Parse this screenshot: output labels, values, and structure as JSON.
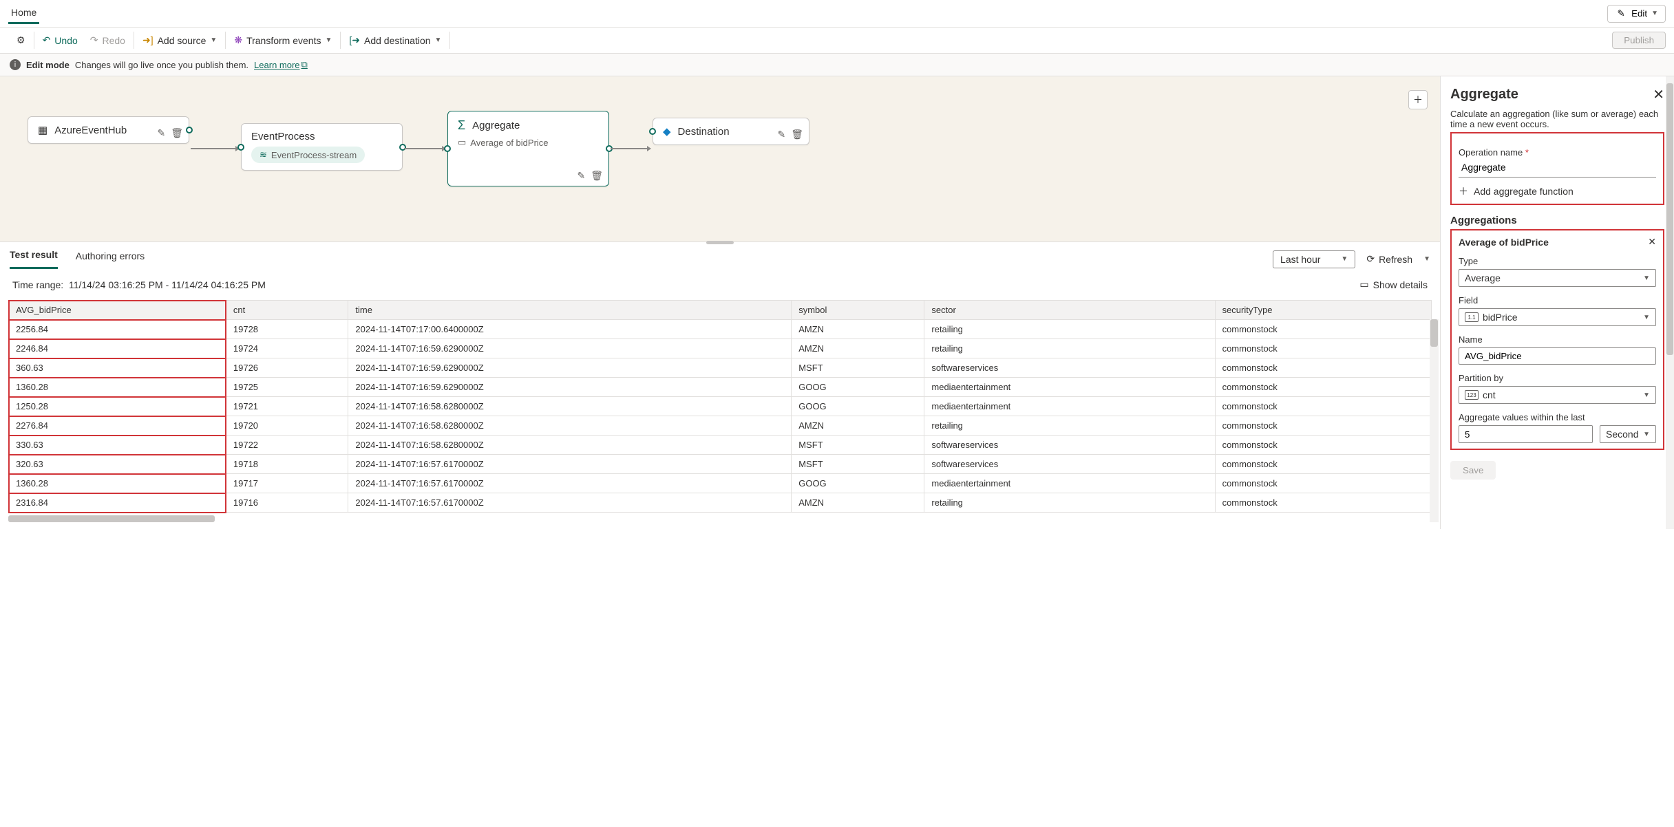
{
  "topbar": {
    "home": "Home",
    "edit": "Edit"
  },
  "toolbar": {
    "undo": "Undo",
    "redo": "Redo",
    "addSource": "Add source",
    "transform": "Transform events",
    "addDest": "Add destination",
    "publish": "Publish"
  },
  "editmode": {
    "title": "Edit mode",
    "msg": "Changes will go live once you publish them.",
    "learn": "Learn more"
  },
  "nodes": {
    "src": {
      "title": "AzureEventHub"
    },
    "proc": {
      "title": "EventProcess",
      "pill": "EventProcess-stream"
    },
    "agg": {
      "title": "Aggregate",
      "sub": "Average of bidPrice"
    },
    "dest": {
      "title": "Destination"
    }
  },
  "tabs": {
    "test": "Test result",
    "errors": "Authoring errors",
    "range": "Last hour",
    "refresh": "Refresh"
  },
  "timeRange": {
    "label": "Time range:",
    "value": "11/14/24 03:16:25 PM - 11/14/24 04:16:25 PM",
    "details": "Show details"
  },
  "table": {
    "cols": [
      "AVG_bidPrice",
      "cnt",
      "time",
      "symbol",
      "sector",
      "securityType"
    ],
    "rows": [
      [
        "2256.84",
        "19728",
        "2024-11-14T07:17:00.6400000Z",
        "AMZN",
        "retailing",
        "commonstock"
      ],
      [
        "2246.84",
        "19724",
        "2024-11-14T07:16:59.6290000Z",
        "AMZN",
        "retailing",
        "commonstock"
      ],
      [
        "360.63",
        "19726",
        "2024-11-14T07:16:59.6290000Z",
        "MSFT",
        "softwareservices",
        "commonstock"
      ],
      [
        "1360.28",
        "19725",
        "2024-11-14T07:16:59.6290000Z",
        "GOOG",
        "mediaentertainment",
        "commonstock"
      ],
      [
        "1250.28",
        "19721",
        "2024-11-14T07:16:58.6280000Z",
        "GOOG",
        "mediaentertainment",
        "commonstock"
      ],
      [
        "2276.84",
        "19720",
        "2024-11-14T07:16:58.6280000Z",
        "AMZN",
        "retailing",
        "commonstock"
      ],
      [
        "330.63",
        "19722",
        "2024-11-14T07:16:58.6280000Z",
        "MSFT",
        "softwareservices",
        "commonstock"
      ],
      [
        "320.63",
        "19718",
        "2024-11-14T07:16:57.6170000Z",
        "MSFT",
        "softwareservices",
        "commonstock"
      ],
      [
        "1360.28",
        "19717",
        "2024-11-14T07:16:57.6170000Z",
        "GOOG",
        "mediaentertainment",
        "commonstock"
      ],
      [
        "2316.84",
        "19716",
        "2024-11-14T07:16:57.6170000Z",
        "AMZN",
        "retailing",
        "commonstock"
      ]
    ]
  },
  "panel": {
    "title": "Aggregate",
    "desc": "Calculate an aggregation (like sum or average) each time a new event occurs.",
    "opName": "Operation name",
    "opVal": "Aggregate",
    "addFn": "Add aggregate function",
    "aggsTitle": "Aggregations",
    "aggHead": "Average of bidPrice",
    "type": "Type",
    "typeVal": "Average",
    "field": "Field",
    "fieldVal": "bidPrice",
    "name": "Name",
    "nameVal": "AVG_bidPrice",
    "partition": "Partition by",
    "partitionVal": "cnt",
    "within": "Aggregate values within the last",
    "withinN": "5",
    "withinU": "Second",
    "save": "Save"
  }
}
